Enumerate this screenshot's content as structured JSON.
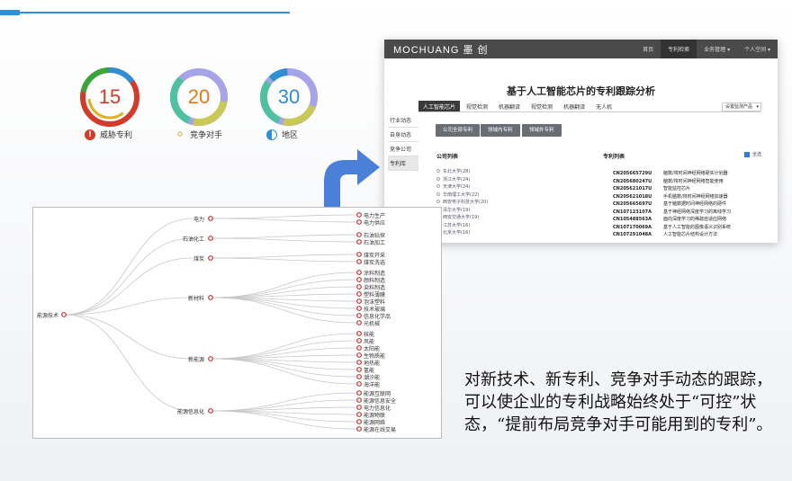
{
  "donuts": [
    {
      "value": "15",
      "caption": "威胁专利",
      "color": "#d23a2a",
      "icon": "alert-icon"
    },
    {
      "value": "20",
      "caption": "竞争对手",
      "color": "#e07b1a",
      "icon": "lightbulb-icon"
    },
    {
      "value": "30",
      "caption": "地区",
      "color": "#2f8ed4",
      "icon": "half-circle-icon"
    }
  ],
  "app": {
    "brand": "MOCHUANG 墨 创",
    "nav": [
      "首页",
      "专利检索",
      "业务管理 ▾",
      "个人空间 ▾"
    ],
    "nav_active": 1,
    "title": "基于人工智能芯片的专利跟踪分析",
    "tabs": [
      "人工智能芯片",
      "视觉检测",
      "机器翻译",
      "视觉检测",
      "机器翻译",
      "无人机"
    ],
    "tabs_active": 0,
    "select_value": "设置监测产品",
    "side": [
      "行业动态",
      "自身动态",
      "竞争公司",
      "专利库"
    ],
    "side_active": 3,
    "buttons": [
      "公司全部专利",
      "领域内专利",
      "领域外专利"
    ],
    "company_list_title": "公司列表",
    "patent_list_title": "专利列表",
    "select_all": "全选",
    "companies": [
      "东北大学(28)",
      "浙江大学(24)",
      "天津大学(24)",
      "华南理工大学(22)",
      "西安电子科技大学(20)",
      "清华大学(19)",
      "西安交通大学(19)",
      "江苏大学(16)",
      "北京大学(16)"
    ],
    "patents": [
      {
        "no": "CN205665729U",
        "title": "脑数/将时间神经网络硬实计划器"
      },
      {
        "no": "CN205680247U",
        "title": "脑数/将时间神经网络智能使用"
      },
      {
        "no": "CN205621017U",
        "title": "智能监控芯片"
      },
      {
        "no": "CN205621018U",
        "title": "手机脑数/将时间神经网络加速器"
      },
      {
        "no": "CN205665697U",
        "title": "基于脑数据时间神经网络的硬件"
      },
      {
        "no": "CN107123107A",
        "title": "基于神经网络深度学习的离线学习"
      },
      {
        "no": "CN105488563A",
        "title": "面向深度学习的稀疏自适应网络"
      },
      {
        "no": "CN107170069A",
        "title": "基于人工智能的图像语义识别系统"
      },
      {
        "no": "CN107291048A",
        "title": "人工智能芯片结构设计方法"
      }
    ]
  },
  "mindmap": {
    "root": "能源技术",
    "branches": [
      {
        "label": "电力",
        "leaves": [
          "电力生产",
          "电力供应"
        ]
      },
      {
        "label": "石油化工",
        "leaves": [
          "石油钻探",
          "石油加工"
        ]
      },
      {
        "label": "煤炭",
        "leaves": [
          "煤炭开采",
          "煤炭洗选"
        ]
      },
      {
        "label": "新材料",
        "leaves": [
          "涂料制造",
          "颜料制造",
          "染料制造",
          "塑料薄膜",
          "泡沫塑料",
          "技术玻璃",
          "信息化学品",
          "光机械"
        ]
      },
      {
        "label": "新能源",
        "leaves": [
          "核能",
          "风能",
          "太阳能",
          "生物质能",
          "地热能",
          "氢能",
          "潮汐能",
          "海洋能"
        ]
      },
      {
        "label": "能源信息化",
        "leaves": [
          "能源互联网",
          "能源信息安全",
          "电力信息化",
          "能源物联",
          "能源网络",
          "能源在线交易"
        ]
      }
    ]
  },
  "description": "对新技术、新专利、竞争对手动态的跟踪，可以使企业的专利战略始终处于“可控”状态，“提前布局竞争对手可能用到的专利”。"
}
